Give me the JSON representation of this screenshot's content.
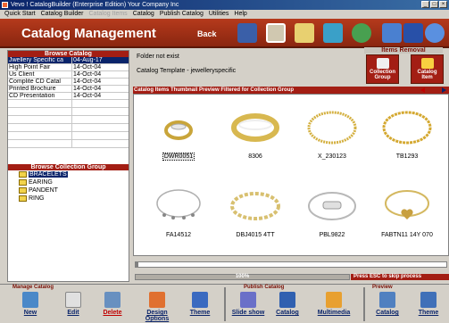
{
  "window": {
    "title": "Vevo ! CatalogBuilder (Enterprise Edition) Your Company Inc"
  },
  "menu": [
    "Quick Start",
    "Catalog Builder",
    "Catalog Items",
    "Catalog",
    "Publish Catalog",
    "Utilities",
    "Help"
  ],
  "header": {
    "title": "Catalog Management",
    "back_label": "Back"
  },
  "browse_catalog": {
    "title": "Browse Catalog",
    "rows": [
      {
        "name": "Jwellery Specific ca",
        "date": "04-Aug-17"
      },
      {
        "name": "High Point Fair",
        "date": "14-Oct-04"
      },
      {
        "name": "Us Client",
        "date": "14-Oct-04"
      },
      {
        "name": "Complite CD Catal",
        "date": "14-Oct-04"
      },
      {
        "name": "Printed Brochure",
        "date": "14-Oct-04"
      },
      {
        "name": "CD Presentation",
        "date": "14-Oct-04"
      }
    ]
  },
  "browse_group": {
    "title": "Browse Collection Group",
    "items": [
      "BRACELETS",
      "EARING",
      "PANDENT",
      "RING"
    ]
  },
  "info": {
    "line1": "Folder not exist",
    "line2": "Catalog Template - jewelleryspecific"
  },
  "removal": {
    "title": "Items Removal",
    "collection_btn": "Collection Group",
    "catalog_btn": "Catalog Item"
  },
  "thumbs_bar": "Catalog Items Thumbnail Preview Filtered for Collection Group",
  "thumbnails": [
    {
      "code": "DWR0051",
      "kind": "ring"
    },
    {
      "code": "8306",
      "kind": "bangle"
    },
    {
      "code": "X_230123",
      "kind": "chain"
    },
    {
      "code": "TB1293",
      "kind": "chain"
    },
    {
      "code": "FA14512",
      "kind": "charm"
    },
    {
      "code": "DBJ4015 4TT",
      "kind": "link"
    },
    {
      "code": "PBL9822",
      "kind": "id"
    },
    {
      "code": "FABTN11 14Y 070",
      "kind": "heart"
    }
  ],
  "progress": {
    "label": "100%",
    "value": 1.0
  },
  "esc_text": "Press ESC to skip process",
  "toolbar": {
    "manage_title": "Manage Catalog",
    "publish_title": "Publish Catalog",
    "preview_title": "Preview",
    "new": "New",
    "edit": "Edit",
    "delete": "Delete",
    "design_options": "Design Options",
    "theme": "Theme",
    "slide_show": "Slide show",
    "catalog": "Catalog",
    "multimedia": "Multimedia",
    "preview_catalog": "Catalog",
    "preview_theme": "Theme"
  },
  "colors": {
    "header": "#a31e14",
    "selection": "#0a246a"
  }
}
